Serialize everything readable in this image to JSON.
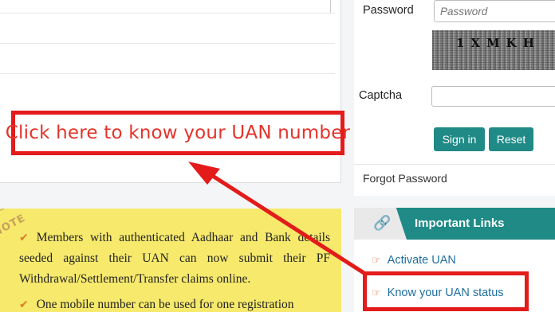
{
  "annotation": {
    "text": "Click here to know your UAN number"
  },
  "note": {
    "tag": "NOTE",
    "items": [
      "Members with authenticated Aadhaar and Bank details seeded against their UAN can now submit their PF Withdrawal/Settlement/Transfer claims online.",
      "One mobile number can be used for one registration"
    ]
  },
  "login": {
    "password_label": "Password",
    "password_placeholder": "Password",
    "captcha_label": "Captcha",
    "captcha_text": "1XMKH",
    "signin_label": "Sign in",
    "reset_label": "Reset",
    "forgot_label": "Forgot Password"
  },
  "important_links": {
    "title": "Important Links",
    "items": [
      "Activate UAN",
      "Know your UAN status"
    ]
  },
  "colors": {
    "accent": "#1f8a86",
    "annotation_red": "#e31b1b",
    "note_bg": "#f6e96c"
  },
  "icons": {
    "check": "check-icon",
    "link": "link-icon",
    "hand": "hand-pointer-icon"
  }
}
